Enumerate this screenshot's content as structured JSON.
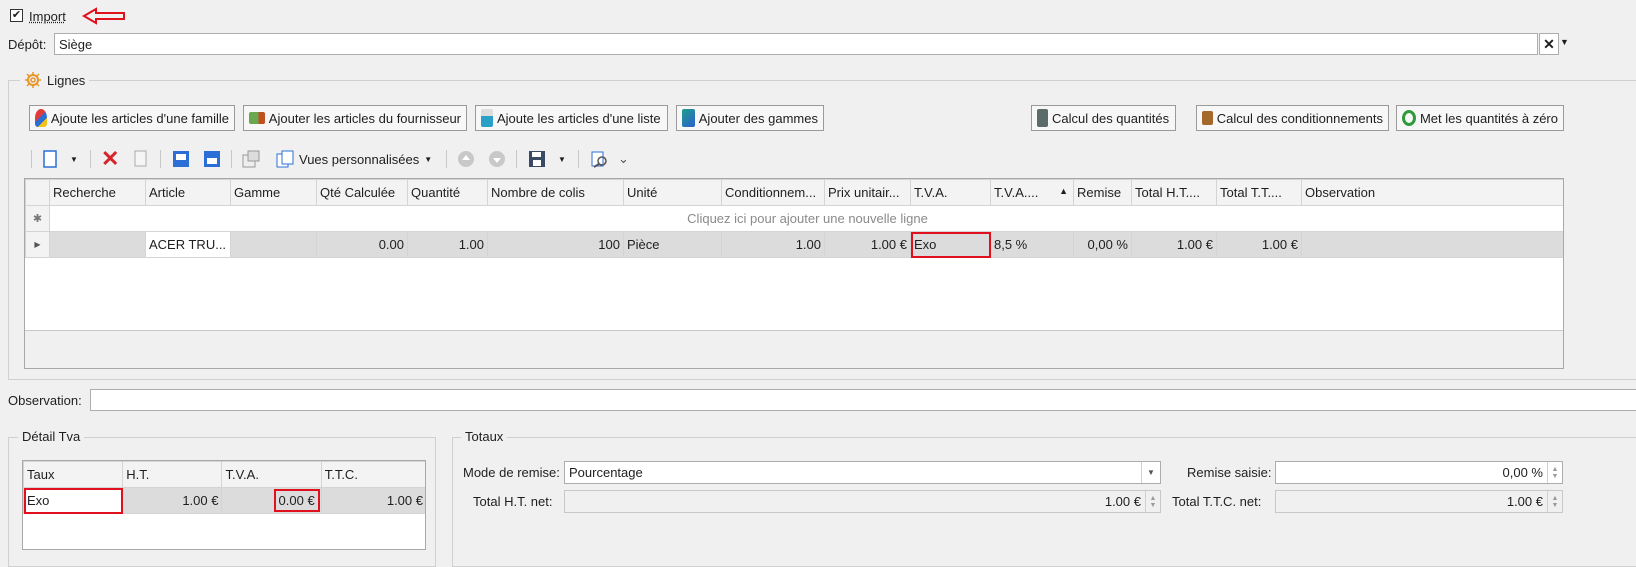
{
  "import": {
    "label": "Import",
    "checked": true
  },
  "depot": {
    "label": "Dépôt:",
    "value": "Siège"
  },
  "lignes": {
    "title": "Lignes",
    "buttons": {
      "famille": "Ajoute les articles d'une famille",
      "fournisseur": "Ajouter les articles du fournisseur",
      "liste": "Ajoute les articles d'une liste",
      "gammes": "Ajouter des gammes",
      "calcul_qte": "Calcul des quantités",
      "calcul_cond": "Calcul des conditionnements",
      "zero": "Met les quantités à zéro"
    },
    "toolbar": {
      "vues": "Vues personnalisées"
    },
    "grid": {
      "columns": [
        "Recherche",
        "Article",
        "Gamme",
        "Qté Calculée",
        "Quantité",
        "Nombre de colis",
        "Unité",
        "Conditionnem...",
        "Prix unitair...",
        "T.V.A.",
        "T.V.A....",
        "Remise",
        "Total H.T....",
        "Total T.T....",
        "Observation"
      ],
      "new_row_hint": "Cliquez ici pour ajouter une nouvelle ligne",
      "rows": [
        {
          "recherche": "",
          "article": "ACER TRU...",
          "gamme": "",
          "qte_calculee": "0.00",
          "quantite": "1.00",
          "nb_colis": "100",
          "unite": "Pièce",
          "conditionnement": "1.00",
          "prix_unitaire": "1.00 €",
          "tva": "Exo",
          "tva_taux": "8,5 %",
          "remise": "0,00 %",
          "total_ht": "1.00 €",
          "total_ttc": "1.00 €",
          "observation": ""
        }
      ]
    }
  },
  "observation": {
    "label": "Observation:",
    "value": ""
  },
  "detail_tva": {
    "title": "Détail Tva",
    "columns": [
      "Taux",
      "H.T.",
      "T.V.A.",
      "T.T.C."
    ],
    "rows": [
      {
        "taux": "Exo",
        "ht": "1.00 €",
        "tva": "0.00 €",
        "ttc": "1.00 €"
      }
    ]
  },
  "totaux": {
    "title": "Totaux",
    "mode_remise_label": "Mode de remise:",
    "mode_remise_value": "Pourcentage",
    "remise_saisie_label": "Remise saisie:",
    "remise_saisie_value": "0,00 %",
    "total_ht_label": "Total H.T. net:",
    "total_ht_value": "1.00 €",
    "total_ttc_label": "Total T.T.C. net:",
    "total_ttc_value": "1.00 €"
  },
  "colors": {
    "highlight": "#e0101c",
    "arrow": "#e0101c"
  }
}
